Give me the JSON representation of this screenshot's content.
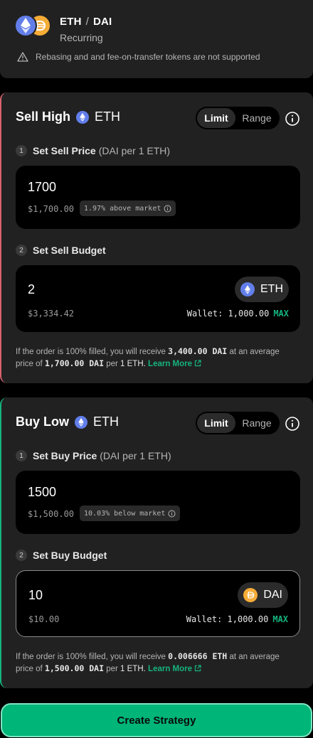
{
  "header": {
    "base_token": "ETH",
    "separator": "/",
    "quote_token": "DAI",
    "subtitle": "Recurring",
    "warning": "Rebasing and and fee-on-transfer tokens are not supported"
  },
  "sell": {
    "title": "Sell High",
    "token": "ETH",
    "toggle": {
      "active": "Limit",
      "inactive": "Range"
    },
    "step1": {
      "num": "1",
      "label": "Set Sell Price",
      "unit": "(DAI per 1 ETH)"
    },
    "price": {
      "value": "1700",
      "fiat": "$1,700.00",
      "badge": "1.97% above market"
    },
    "step2": {
      "num": "2",
      "label": "Set Sell Budget"
    },
    "budget": {
      "value": "2",
      "fiat": "$3,334.42",
      "token": "ETH",
      "wallet": "Wallet: 1,000.00",
      "max": "MAX"
    },
    "note": {
      "prefix": "If the order is 100% filled, you will receive",
      "receive": "3,400.00 DAI",
      "middle": "at an average price of",
      "price": "1,700.00 DAI",
      "per": "per",
      "per_token": "1 ETH.",
      "learn": "Learn More"
    }
  },
  "buy": {
    "title": "Buy Low",
    "token": "ETH",
    "toggle": {
      "active": "Limit",
      "inactive": "Range"
    },
    "step1": {
      "num": "1",
      "label": "Set Buy Price",
      "unit": "(DAI per 1 ETH)"
    },
    "price": {
      "value": "1500",
      "fiat": "$1,500.00",
      "badge": "10.03% below market"
    },
    "step2": {
      "num": "2",
      "label": "Set Buy Budget"
    },
    "budget": {
      "value": "10",
      "fiat": "$10.00",
      "token": "DAI",
      "wallet": "Wallet: 1,000.00",
      "max": "MAX"
    },
    "note": {
      "prefix": "If the order is 100% filled, you will receive",
      "receive": "0.006666 ETH",
      "middle": "at an average price of",
      "price": "1,500.00 DAI",
      "per": "per",
      "per_token": "1 ETH.",
      "learn": "Learn More"
    }
  },
  "create_button": "Create Strategy",
  "colors": {
    "sell_accent": "#d8626e",
    "buy_accent": "#15b37f",
    "primary_button": "#00b578",
    "eth_icon": "#627eea",
    "dai_icon": "#f5ac37"
  },
  "icons": [
    "eth-icon",
    "dai-icon",
    "warning-icon",
    "info-icon",
    "external-link-icon"
  ]
}
